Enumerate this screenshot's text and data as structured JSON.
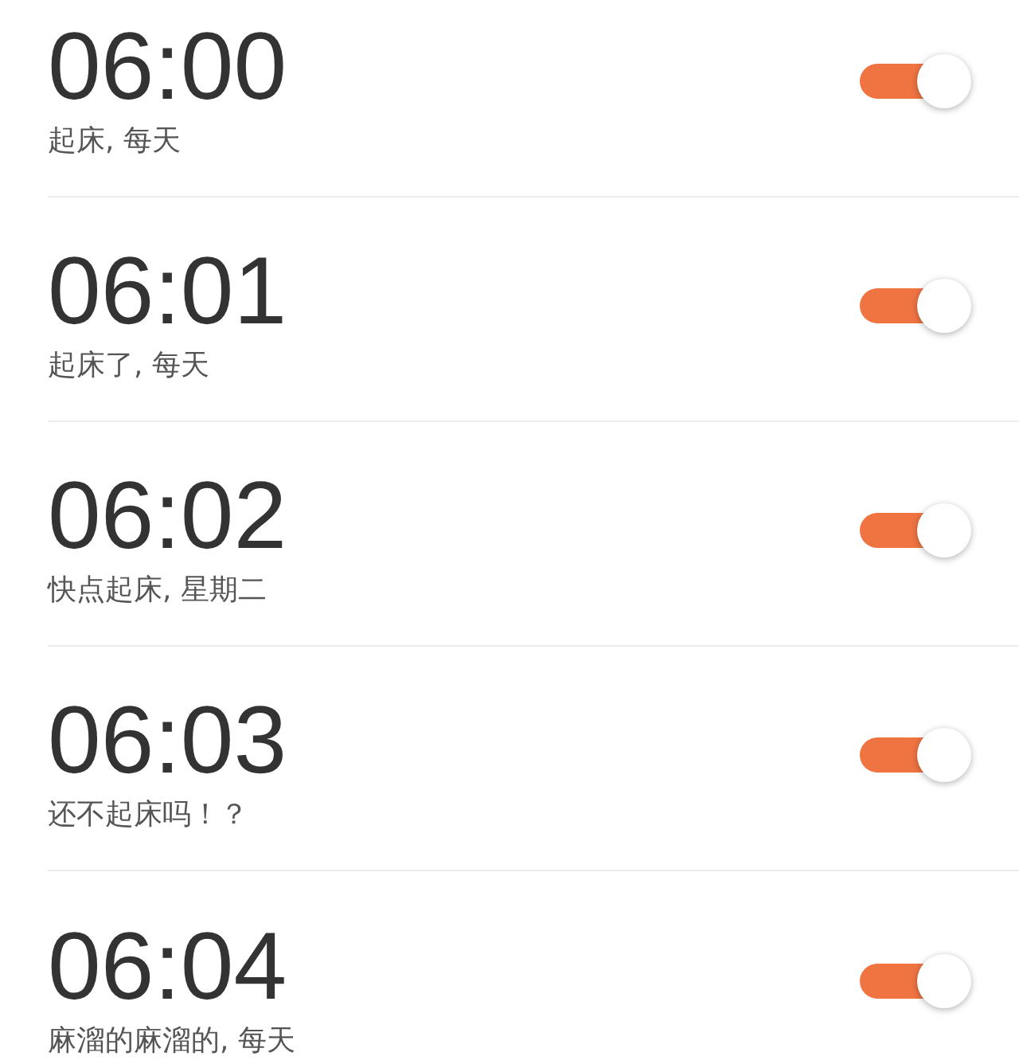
{
  "alarms": [
    {
      "time": "06:00",
      "label": "起床, 每天",
      "on": true
    },
    {
      "time": "06:01",
      "label": "起床了, 每天",
      "on": true
    },
    {
      "time": "06:02",
      "label": "快点起床, 星期二",
      "on": true
    },
    {
      "time": "06:03",
      "label": "还不起床吗！？",
      "on": true
    },
    {
      "time": "06:04",
      "label": "麻溜的麻溜的, 每天",
      "on": true
    }
  ]
}
